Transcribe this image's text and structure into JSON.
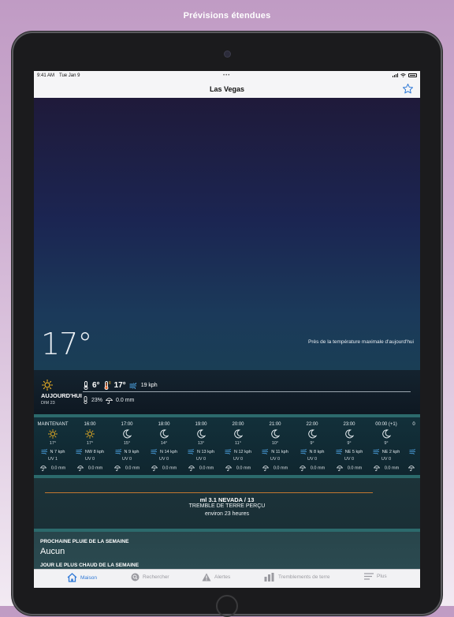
{
  "banner": {
    "title": "Prévisions étendues"
  },
  "status": {
    "time": "9:41 AM",
    "date": "Tue Jan 9"
  },
  "nav": {
    "title": "Las Vegas"
  },
  "hero": {
    "temp": "17°",
    "note": "Près de la température maximale d'aujourd'hui"
  },
  "today": {
    "label": "AUJOURD'HUI",
    "date": "DIM 23",
    "low": "6°",
    "high": "17°",
    "wind": "19 kph",
    "rain_chance": "23%",
    "rain_amount": "0.0 mm"
  },
  "hourly": [
    {
      "time": "MAINTENANT",
      "icon": "sun-icon",
      "temp": "17°",
      "wind": "N 7 kph",
      "uv": "UV 1",
      "rain": "0.0 mm"
    },
    {
      "time": "16:00",
      "icon": "sun-icon",
      "temp": "17°",
      "wind": "NW 8 kph",
      "uv": "UV 0",
      "rain": "0.0 mm"
    },
    {
      "time": "17:00",
      "icon": "moon-icon",
      "temp": "15°",
      "wind": "N 9 kph",
      "uv": "UV 0",
      "rain": "0.0 mm"
    },
    {
      "time": "18:00",
      "icon": "moon-icon",
      "temp": "14°",
      "wind": "N 14 kph",
      "uv": "UV 0",
      "rain": "0.0 mm"
    },
    {
      "time": "19:00",
      "icon": "moon-icon",
      "temp": "13°",
      "wind": "N 13 kph",
      "uv": "UV 0",
      "rain": "0.0 mm"
    },
    {
      "time": "20:00",
      "icon": "moon-icon",
      "temp": "11°",
      "wind": "N 12 kph",
      "uv": "UV 0",
      "rain": "0.0 mm"
    },
    {
      "time": "21:00",
      "icon": "moon-icon",
      "temp": "10°",
      "wind": "N 11 kph",
      "uv": "UV 0",
      "rain": "0.0 mm"
    },
    {
      "time": "22:00",
      "icon": "moon-icon",
      "temp": "9°",
      "wind": "N 8 kph",
      "uv": "UV 0",
      "rain": "0.0 mm"
    },
    {
      "time": "23:00",
      "icon": "moon-icon",
      "temp": "9°",
      "wind": "NE 5 kph",
      "uv": "UV 0",
      "rain": "0.0 mm"
    },
    {
      "time": "00:00 (+1)",
      "icon": "moon-icon",
      "temp": "9°",
      "wind": "NE 2 kph",
      "uv": "UV 0",
      "rain": "0.0 mm"
    },
    {
      "time": "0",
      "icon": "",
      "temp": "",
      "wind": "",
      "uv": "",
      "rain": ""
    }
  ],
  "quake": {
    "title": "ml 3.1  NEVADA / 13",
    "subtitle": "TREMBLE DE TERRE PERÇU",
    "time": "environ 23 heures"
  },
  "rain": {
    "label": "PROCHAINE PLUIE DE LA SEMAINE",
    "value": "Aucun"
  },
  "hot": {
    "label": "JOUR LE PLUS CHAUD DE LA SEMAINE"
  },
  "tabs": [
    {
      "label": "Maison",
      "icon": "home-icon"
    },
    {
      "label": "Rechercher",
      "icon": "search-icon"
    },
    {
      "label": "Alertes",
      "icon": "warning-icon"
    },
    {
      "label": "Tremblements de terre",
      "icon": "chart-bars-icon"
    },
    {
      "label": "Plus",
      "icon": "menu-icon"
    }
  ],
  "colors": {
    "accent": "#2e78d6",
    "quake_line": "#c3772f",
    "band": "#2c6a6c"
  }
}
